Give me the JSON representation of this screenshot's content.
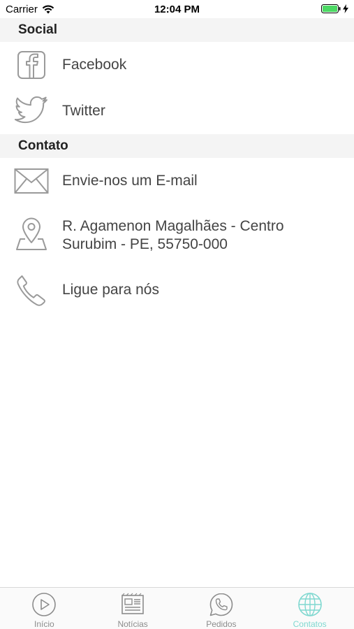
{
  "status_bar": {
    "carrier": "Carrier",
    "time": "12:04 PM",
    "battery_color": "#4cd964"
  },
  "sections": {
    "social": {
      "title": "Social",
      "items": [
        {
          "label": "Facebook",
          "icon": "facebook-icon"
        },
        {
          "label": "Twitter",
          "icon": "twitter-icon"
        }
      ]
    },
    "contato": {
      "title": "Contato",
      "items": [
        {
          "label": "Envie-nos um E-mail",
          "icon": "mail-icon"
        },
        {
          "label_line1": "R. Agamenon Magalhães - Centro",
          "label_line2": "Surubim - PE, 55750-000",
          "icon": "location-pin-icon"
        },
        {
          "label": "Ligue para nós",
          "icon": "phone-icon"
        }
      ]
    }
  },
  "tab_bar": {
    "active_color": "#7fd8d0",
    "inactive_color": "#8c8c8c",
    "tabs": [
      {
        "label": "Início",
        "icon": "play-circle-icon"
      },
      {
        "label": "Notícias",
        "icon": "newspaper-icon"
      },
      {
        "label": "Pedidos",
        "icon": "whatsapp-icon"
      },
      {
        "label": "Contatos",
        "icon": "globe-icon",
        "active": true
      }
    ]
  }
}
